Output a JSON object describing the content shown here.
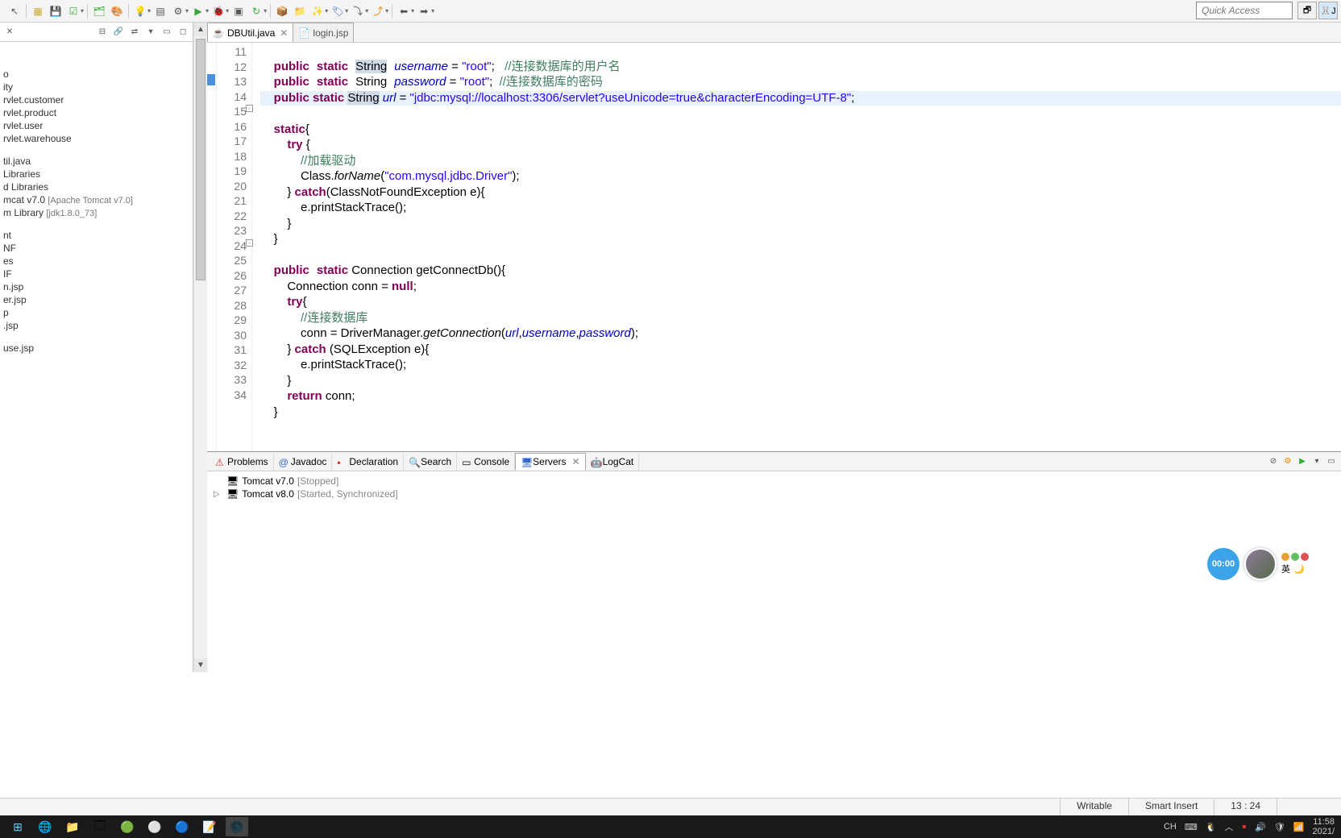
{
  "quick_access_placeholder": "Quick Access",
  "sidebar": {
    "items_group1": [
      "o",
      "ity",
      "rvlet.customer",
      "rvlet.product",
      "rvlet.user",
      "rvlet.warehouse"
    ],
    "items_group2": [
      "til.java",
      "Libraries",
      "d Libraries"
    ],
    "tomcat_item": "mcat v7.0 ",
    "tomcat_bracket": "[Apache Tomcat v7.0]",
    "jdk_item": "m Library ",
    "jdk_bracket": "[jdk1.8.0_73]",
    "items_group3": [
      "nt",
      "NF",
      "es",
      "IF",
      "n.jsp",
      "er.jsp",
      "p",
      ".jsp"
    ],
    "items_group4": [
      "use.jsp"
    ]
  },
  "tabs": {
    "active": "DBUtil.java",
    "inactive": "login.jsp"
  },
  "code": {
    "lines": [
      11,
      12,
      13,
      14,
      15,
      16,
      17,
      18,
      19,
      20,
      21,
      22,
      23,
      24,
      25,
      26,
      27,
      28,
      29,
      30,
      31,
      32,
      33,
      34
    ],
    "l11_pre": "    ",
    "l11_kw1": "public",
    "l11_kw2": "static",
    "l11_type": "String",
    "l11_field": "username",
    "l11_eq": " = ",
    "l11_str": "\"root\"",
    "l11_semi": ";   ",
    "l11_cmt": "//连接数据库的用户名",
    "l12_pre": "    ",
    "l12_kw1": "public",
    "l12_kw2": "static",
    "l12_type": "String",
    "l12_field": "password",
    "l12_eq": " = ",
    "l12_str": "\"root\"",
    "l12_semi": ";  ",
    "l12_cmt": "//连接数据库的密码",
    "l13_pre": "    ",
    "l13_kw1": "public",
    "l13_kw2": "static",
    "l13_type": "String",
    "l13_field": "url",
    "l13_eq": " = ",
    "l13_str": "\"jdbc:mysql://localhost:3306/servlet?useUnicode=true&characterEncoding=UTF-8\"",
    "l13_semi": ";",
    "l14": "",
    "l15_pre": "    ",
    "l15_kw": "static",
    "l15_brace": "{",
    "l16_pre": "        ",
    "l16_kw": "try",
    "l16_brace": " {",
    "l17_pre": "            ",
    "l17_cmt": "//加载驱动",
    "l18_pre": "            Class.",
    "l18_method": "forName",
    "l18_open": "(",
    "l18_str": "\"com.mysql.jdbc.Driver\"",
    "l18_close": ");",
    "l19_pre": "        } ",
    "l19_kw": "catch",
    "l19_rest": "(ClassNotFoundException e){",
    "l20": "            e.printStackTrace();",
    "l21": "        }",
    "l22": "    }",
    "l23": "",
    "l24_pre": "    ",
    "l24_kw1": "public",
    "l24_kw2": "static",
    "l24_rest": " Connection getConnectDb(){",
    "l25_pre": "        Connection conn = ",
    "l25_kw": "null",
    "l25_semi": ";",
    "l26_pre": "        ",
    "l26_kw": "try",
    "l26_brace": "{",
    "l27_pre": "            ",
    "l27_cmt": "//连接数据库",
    "l28_pre": "            conn = DriverManager.",
    "l28_method": "getConnection",
    "l28_open": "(",
    "l28_a1": "url",
    "l28_c1": ",",
    "l28_a2": "username",
    "l28_c2": ",",
    "l28_a3": "password",
    "l28_close": ");",
    "l29_pre": "        } ",
    "l29_kw": "catch",
    "l29_rest": " (SQLException e){",
    "l30": "            e.printStackTrace();",
    "l31": "        }",
    "l32_pre": "        ",
    "l32_kw": "return",
    "l32_rest": " conn;",
    "l33": "    }",
    "l34": ""
  },
  "bottom_tabs": {
    "problems": "Problems",
    "javadoc": "Javadoc",
    "declaration": "Declaration",
    "search": "Search",
    "console": "Console",
    "servers": "Servers",
    "logcat": "LogCat"
  },
  "servers": {
    "s1_name": "Tomcat v7.0",
    "s1_status": "[Stopped]",
    "s2_name": "Tomcat v8.0",
    "s2_status": "[Started, Synchronized]"
  },
  "status": {
    "writable": "Writable",
    "insert": "Smart Insert",
    "pos": "13 : 24"
  },
  "float": {
    "badge": "00:00",
    "lang": "英"
  },
  "systray": {
    "ime": "CH",
    "time": "11:58",
    "date": "2021/"
  }
}
